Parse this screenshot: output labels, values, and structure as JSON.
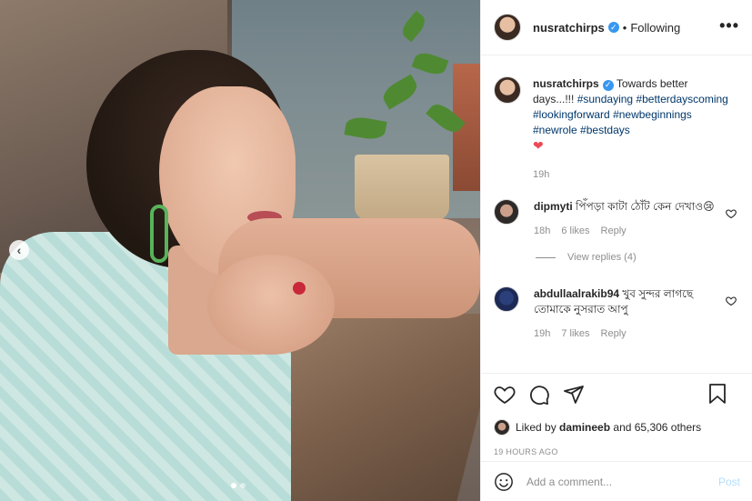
{
  "header": {
    "username": "nusratchirps",
    "separator": "•",
    "follow_status": "Following",
    "more_label": "•••"
  },
  "photo": {
    "prev_label": "‹",
    "slides": 2,
    "active_slide": 1
  },
  "caption": {
    "username": "nusratchirps",
    "text": "Towards better days...!!!",
    "hashtags": [
      "#sundaying",
      "#betterdayscoming",
      "#lookingforward",
      "#newbeginnings",
      "#newrole",
      "#bestdays"
    ],
    "emoji": "❤",
    "time": "19h"
  },
  "comments": [
    {
      "username": "dipmyti",
      "text": "পিঁপড়া কাটা ঠোঁট কেন দেখাও😢",
      "time": "18h",
      "likes": "6 likes",
      "reply": "Reply"
    },
    {
      "username": "abdullaalrakib94",
      "text": "খুব সুন্দর লাগছে তোমাকে নুসরাত আপু",
      "time": "19h",
      "likes": "7 likes",
      "reply": "Reply"
    }
  ],
  "view_replies": "View replies (4)",
  "likes": {
    "liked_by_prefix": "Liked by",
    "liked_by_user": "damineeb",
    "liked_by_rest": "and 65,306 others"
  },
  "timestamp": "19 HOURS AGO",
  "add_comment": {
    "placeholder": "Add a comment...",
    "post_label": "Post"
  },
  "icons": {
    "like": "heart-icon",
    "comment": "comment-icon",
    "share": "share-icon",
    "save": "bookmark-icon",
    "emoji": "smiley-icon",
    "verified": "verified-badge-icon"
  },
  "colors": {
    "verified": "#3897f0",
    "hashtag": "#00376b",
    "heart": "#ed4956",
    "muted": "#8e8e8e",
    "post_disabled": "#b2dffc"
  }
}
